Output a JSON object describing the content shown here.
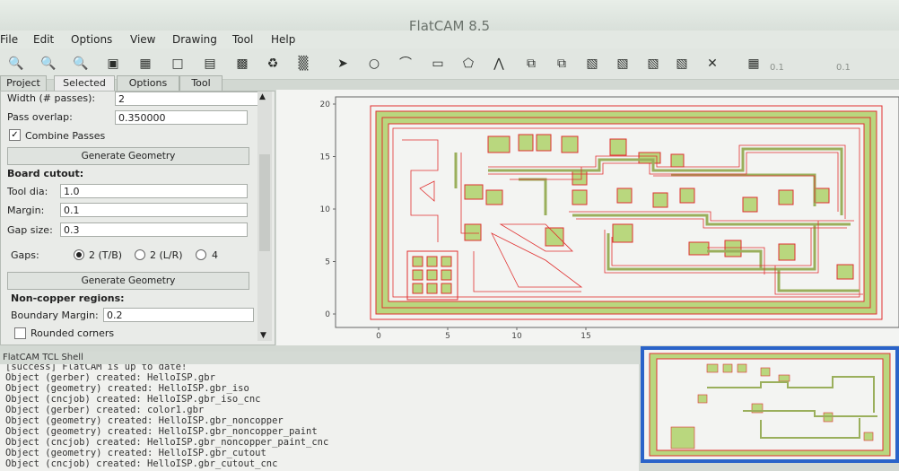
{
  "window": {
    "title": "FlatCAM 8.5"
  },
  "menu": [
    "File",
    "Edit",
    "Options",
    "View",
    "Drawing",
    "Tool",
    "Help"
  ],
  "toolbar": {
    "icons": [
      "zoom-fit-icon",
      "zoom-in-icon",
      "zoom-out-icon",
      "replot-icon",
      "clear-plot-icon",
      "new-file-icon",
      "open-file-icon",
      "save-icon",
      "delete-icon",
      "shell-icon",
      "select-icon",
      "circle-icon",
      "arc-icon",
      "rectangle-icon",
      "polygon-icon",
      "path-icon",
      "move-icon",
      "copy-icon",
      "union-icon",
      "intersection-icon",
      "subtract-icon",
      "cut-icon",
      "cancel-icon",
      "grid-icon"
    ],
    "grid_x": "0.1",
    "grid_y": "0.1"
  },
  "tabs": [
    "Project",
    "Selected",
    "Options",
    "Tool"
  ],
  "selected_tab": "Selected",
  "panel": {
    "width_label": "Width (# passes):",
    "width_value": "2",
    "overlap_label": "Pass overlap:",
    "overlap_value": "0.350000",
    "combine_label": "Combine Passes",
    "combine_checked": true,
    "generate1": "Generate Geometry",
    "board_cutout": "Board cutout:",
    "tool_dia_label": "Tool dia:",
    "tool_dia_value": "1.0",
    "margin_label": "Margin:",
    "margin_value": "0.1",
    "gap_label": "Gap size:",
    "gap_value": "0.3",
    "gaps_label": "Gaps:",
    "gaps_options": [
      "2 (T/B)",
      "2 (L/R)",
      "4"
    ],
    "gaps_selected": "2 (T/B)",
    "generate2": "Generate Geometry",
    "noncopper": "Non-copper regions:",
    "boundary_label": "Boundary Margin:",
    "boundary_value": "0.2",
    "rounded_label": "Rounded corners",
    "rounded_checked": false
  },
  "chart_data": {
    "type": "scatter",
    "x_ticks": [
      "0",
      "5",
      "10",
      "15"
    ],
    "y_ticks": [
      "20",
      "15",
      "10",
      "5",
      "0"
    ],
    "xlim": [
      0,
      36
    ],
    "ylim": [
      -0.5,
      20
    ],
    "grid": false
  },
  "colors": {
    "copper_fill": "#b9d77e",
    "trace_outline": "#e03030",
    "mini_border": "#2a63c9"
  },
  "shell": {
    "title": "FlatCAM TCL Shell",
    "lines": [
      "[success] FlatCAM is up to date!",
      "Object (gerber) created: HelloISP.gbr",
      "Object (geometry) created: HelloISP.gbr_iso",
      "Object (cncjob) created: HelloISP.gbr_iso_cnc",
      "Object (gerber) created: color1.gbr",
      "Object (geometry) created: HelloISP.gbr_noncopper",
      "Object (geometry) created: HelloISP.gbr_noncopper_paint",
      "Object (cncjob) created: HelloISP.gbr_noncopper_paint_cnc",
      "Object (geometry) created: HelloISP.gbr_cutout",
      "Object (cncjob) created: HelloISP.gbr_cutout_cnc"
    ]
  }
}
